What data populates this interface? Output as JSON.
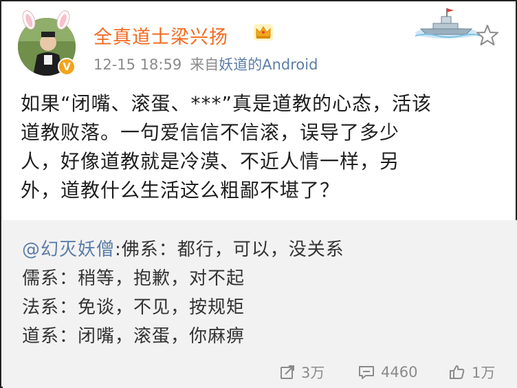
{
  "user": {
    "name": "全真道士梁兴扬",
    "verified_badge": "V"
  },
  "meta": {
    "timestamp": "12-15 18:59",
    "source_prefix": "来自",
    "source_name": "妖道的Android"
  },
  "post": {
    "lines": [
      "如果“闭嘴、滚蛋、***”真是道教的心态，活该",
      "道教败落。一句爱信信不信滚，误导了多少",
      "人，好像道教就是冷漠、不近人情一样，另",
      "外，道教什么生活这么粗鄙不堪了？"
    ]
  },
  "quote": {
    "mention": "@幻灭妖僧",
    "line1_rest": ":佛系：都行，可以，没关系",
    "line2": "儒系：稍等，抱歉，对不起",
    "line3": "法系：免谈，不见，按规矩",
    "line4": "道系：闭嘴，滚蛋，你麻痹"
  },
  "actions": {
    "repost_count": "3万",
    "comment_count": "4460",
    "like_count": "1万"
  },
  "colors": {
    "username": "#f26a21",
    "link": "#5b7da8",
    "muted": "#8a8a8a",
    "quote_bg": "#f2f2f2"
  },
  "icons": [
    "bunny-ears-icon",
    "verified-badge-icon",
    "crown-icon",
    "ship-sticker-icon",
    "star-icon",
    "repost-icon",
    "comment-icon",
    "like-icon"
  ]
}
